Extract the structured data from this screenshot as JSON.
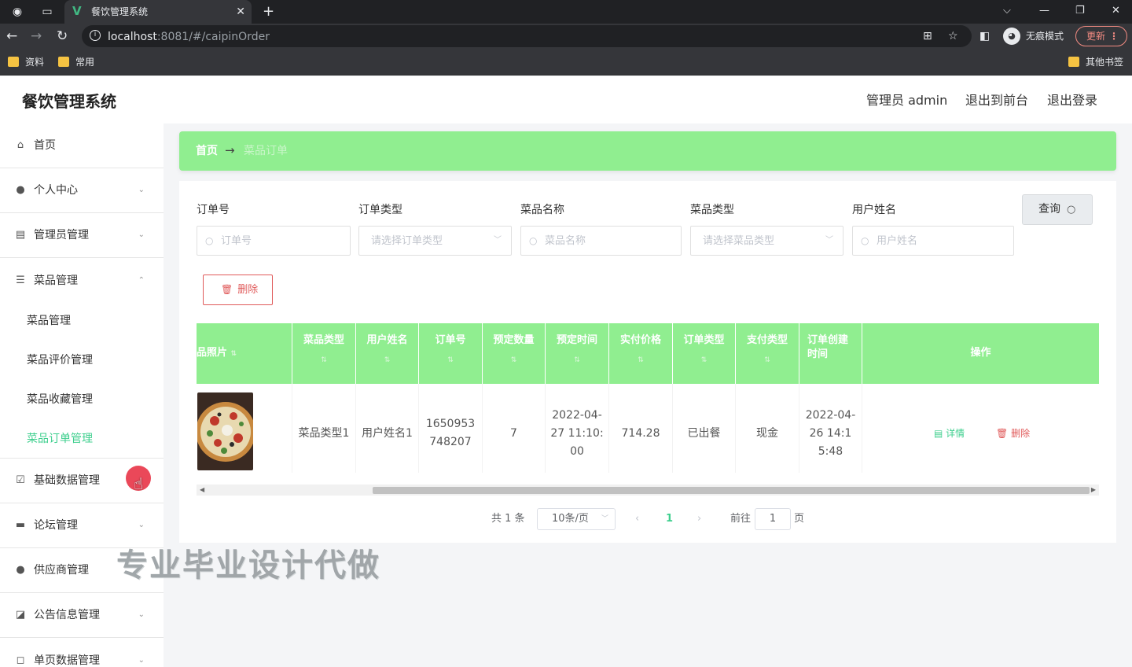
{
  "browser": {
    "tab_title": "餐饮管理系统",
    "tab_logo": "V",
    "url_host": "localhost",
    "url_rest": ":8081/#/caipinOrder",
    "incognito_label": "无痕模式",
    "update_label": "更新",
    "bookmarks": [
      "资料",
      "常用"
    ],
    "other_bookmarks": "其他书签"
  },
  "header": {
    "app_title": "餐饮管理系统",
    "admin_label": "管理员 admin",
    "front_link": "退出到前台",
    "logout_link": "退出登录"
  },
  "sidebar": {
    "items": [
      {
        "label": "首页",
        "icon": "home-icon"
      },
      {
        "label": "个人中心",
        "icon": "user-icon"
      },
      {
        "label": "管理员管理",
        "icon": "document-icon"
      },
      {
        "label": "菜品管理",
        "icon": "sliders-icon"
      },
      {
        "label": "基础数据管理",
        "icon": "checklist-icon"
      },
      {
        "label": "论坛管理",
        "icon": "briefcase-icon"
      },
      {
        "label": "供应商管理",
        "icon": "user-icon"
      },
      {
        "label": "公告信息管理",
        "icon": "chart-icon"
      },
      {
        "label": "单页数据管理",
        "icon": "page-icon"
      }
    ],
    "sub_items": [
      "菜品管理",
      "菜品评价管理",
      "菜品收藏管理",
      "菜品订单管理"
    ],
    "active_sub": "菜品订单管理",
    "accent_color": "#3ecf8e"
  },
  "breadcrumb": {
    "home": "首页",
    "separator": "→",
    "current": "菜品订单"
  },
  "filters": {
    "order_no": {
      "label": "订单号",
      "placeholder": "订单号"
    },
    "order_type": {
      "label": "订单类型",
      "placeholder": "请选择订单类型"
    },
    "dish_name": {
      "label": "菜品名称",
      "placeholder": "菜品名称"
    },
    "dish_type": {
      "label": "菜品类型",
      "placeholder": "请选择菜品类型"
    },
    "user_name": {
      "label": "用户姓名",
      "placeholder": "用户姓名"
    },
    "query_label": "查询"
  },
  "delete_label": "删除",
  "table": {
    "header_color": "#90ee90",
    "columns": [
      "品照片",
      "菜品类型",
      "用户姓名",
      "订单号",
      "预定数量",
      "预定时间",
      "实付价格",
      "订单类型",
      "支付类型",
      "订单创建时间",
      "操作"
    ],
    "row": {
      "dish_type": "菜品类型1",
      "user_name": "用户姓名1",
      "order_no": "1650953748207",
      "quantity": "7",
      "reserve_time": "2022-04-27 11:10:00",
      "price": "714.28",
      "order_type": "已出餐",
      "pay_type": "现金",
      "created_time": "2022-04-26 14:15:48",
      "detail_label": "详情",
      "delete_label": "删除"
    }
  },
  "pagination": {
    "total": "共 1 条",
    "page_size": "10条/页",
    "current_page": "1",
    "goto_label": "前往",
    "goto_value": "1",
    "page_unit": "页"
  },
  "watermark": "专业毕业设计代做"
}
